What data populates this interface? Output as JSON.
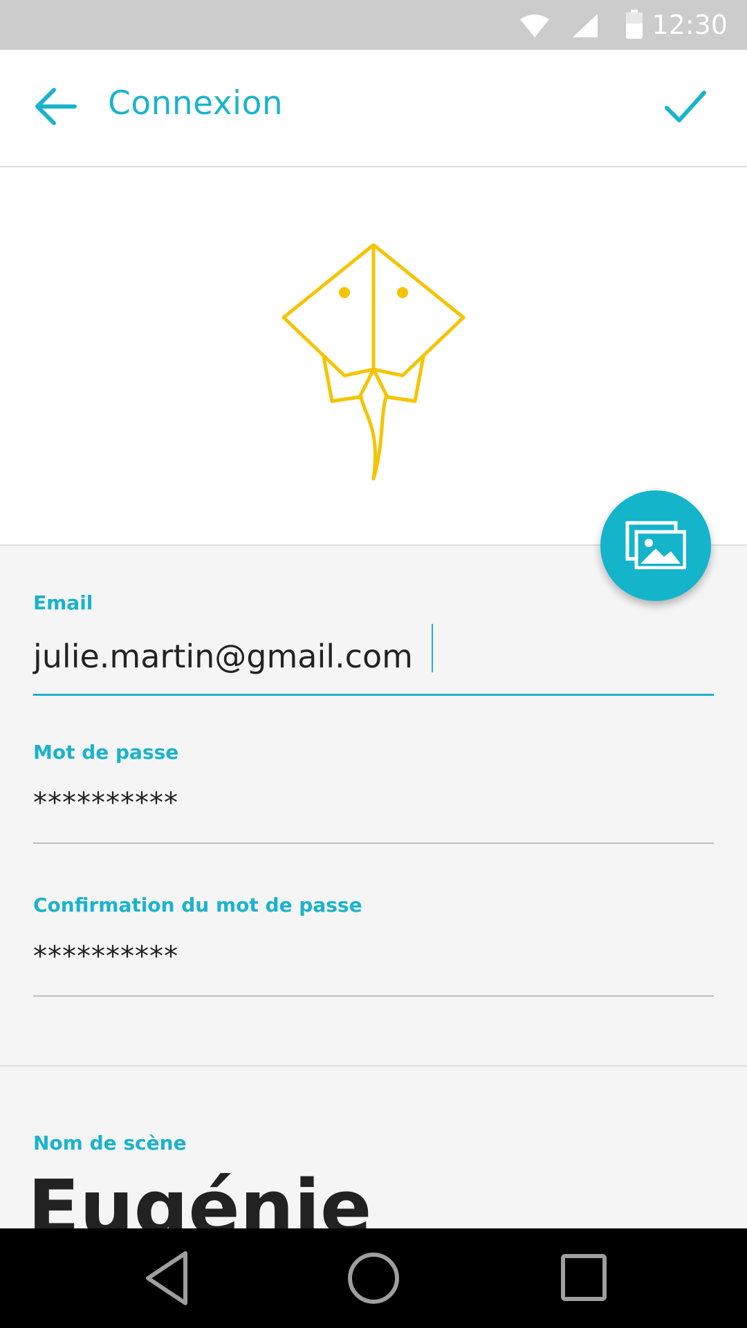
{
  "status_bar": {
    "time": "12:30",
    "icons": [
      "wifi-icon",
      "signal-icon",
      "battery-icon"
    ]
  },
  "app_bar": {
    "title": "Connexion",
    "back_icon": "arrow-left-icon",
    "confirm_icon": "checkmark-icon"
  },
  "hero": {
    "logo": "stingray-logo",
    "fab_icon": "gallery-icon"
  },
  "form": {
    "email": {
      "label": "Email",
      "value": "julie.martin@gmail.com"
    },
    "password": {
      "label": "Mot de passe",
      "value": "**********"
    },
    "password_confirm": {
      "label": "Confirmation du mot de passe",
      "value": "**********"
    },
    "stage_name": {
      "label": "Nom de scène",
      "value": "Eugénie"
    }
  },
  "nav_bar": {
    "icons": [
      "back-triangle-icon",
      "home-circle-icon",
      "recents-square-icon"
    ]
  },
  "colors": {
    "accent": "#1ab3cc",
    "logo": "#f5c400",
    "status_bar": "#cccccc",
    "background": "#f5f5f5"
  }
}
